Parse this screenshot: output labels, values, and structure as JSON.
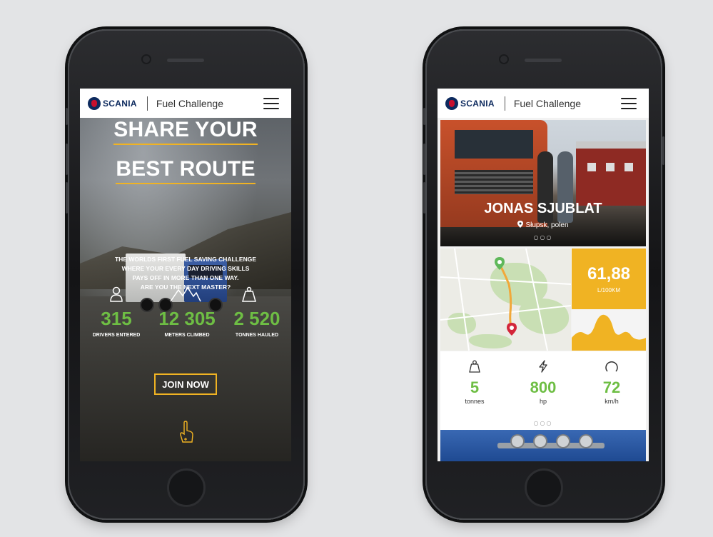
{
  "app": {
    "brand": "SCANIA",
    "title": "Fuel Challenge"
  },
  "left_screen": {
    "hero": {
      "title_line1": "SHARE YOUR",
      "title_line2": "BEST ROUTE",
      "subtitle_lines": [
        "THE WORLDS FIRST FUEL SAVING CHALLENGE",
        "WHERE YOUR EVERY DAY DRIVING SKILLS",
        "PAYS OFF IN MORE THAN ONE WAY.",
        "ARE YOU THE NEXT MASTER?"
      ]
    },
    "stats": [
      {
        "value": "315",
        "label": "DRIVERS ENTERED",
        "icon": "person-icon"
      },
      {
        "value": "12 305",
        "label": "METERS CLIMBED",
        "icon": "mountains-icon"
      },
      {
        "value": "2 520",
        "label": "TONNES HAULED",
        "icon": "weight-icon"
      }
    ],
    "cta": "JOIN NOW",
    "swipe_icon": "swipe-up-hand-icon"
  },
  "right_screen": {
    "profile": {
      "name": "JONAS SJUBLAT",
      "location": "Słupsk, polen",
      "pager": "○○○"
    },
    "score": {
      "value": "61,88",
      "unit": "L/100KM"
    },
    "specs": [
      {
        "value": "5",
        "unit": "tonnes",
        "icon": "weight-icon"
      },
      {
        "value": "800",
        "unit": "hp",
        "icon": "lightning-icon"
      },
      {
        "value": "72",
        "unit": "km/h",
        "icon": "speedometer-icon"
      }
    ],
    "specs_pager": "○○○"
  },
  "colors": {
    "accent_yellow": "#f0b323",
    "accent_green": "#6ebe44",
    "brand_blue": "#0d2a5e"
  }
}
